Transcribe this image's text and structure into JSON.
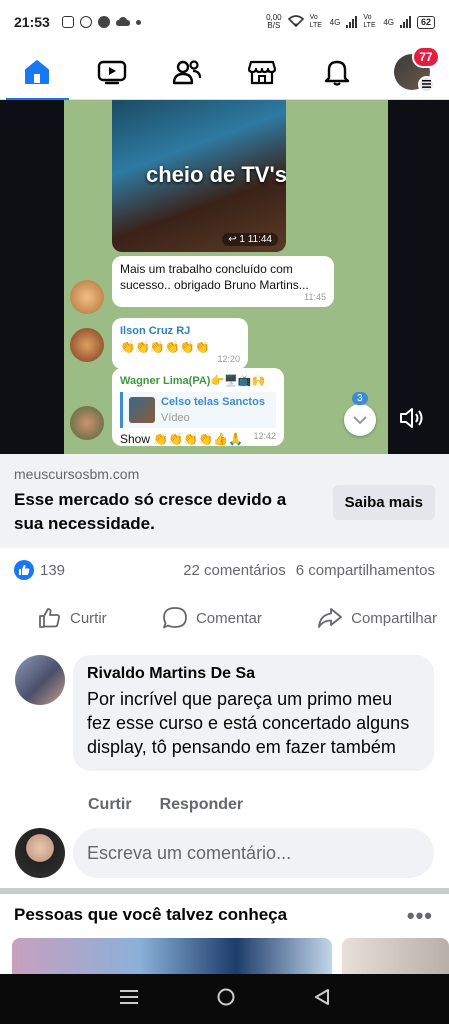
{
  "status_bar": {
    "time": "21:53",
    "net_rate_value": "0,00",
    "net_rate_unit": "B/S",
    "vo_lte_1": "Vo LTE",
    "net_1": "4G",
    "vo_lte_2": "Vo LTE",
    "net_2": "4G",
    "battery": "62"
  },
  "nav": {
    "tabs": [
      "home-tab",
      "video-tab",
      "friends-tab",
      "marketplace-tab",
      "notifications-tab",
      "menu-tab"
    ],
    "notification_badge": "77",
    "accent_color": "#1877f2"
  },
  "video": {
    "chat_image_title": "cheio de TV's",
    "chat_image_meta": "↩ 1 11:44",
    "bubble1_text": "Mais um trabalho concluído com sucesso.. obrigado Bruno Martins...",
    "bubble1_time": "11:45",
    "bubble2_name": "Ilson Cruz RJ",
    "bubble2_text": "👏👏👏👏👏👏",
    "bubble2_time": "12:20",
    "bubble3_name": "Wagner Lima(PA)👉🖥️📺🙌",
    "bubble3_reply_name": "Celso telas Sanctos",
    "bubble3_reply_sub": "Vídeo",
    "bubble3_text": "Show 👏👏👏👏👍🙏",
    "bubble3_time": "12:42",
    "scroll_badge": "3"
  },
  "ad": {
    "domain": "meuscursosbm.com",
    "headline": "Esse mercado só cresce devido a sua necessidade.",
    "cta": "Saiba mais"
  },
  "reactions": {
    "likes": "139",
    "comments": "22 comentários",
    "shares": "6 compartilhamentos"
  },
  "actions": {
    "like": "Curtir",
    "comment": "Comentar",
    "share": "Compartilhar"
  },
  "comment": {
    "author": "Rivaldo Martins De Sa",
    "text": "Por incrível que pareça um primo meu fez esse curso e está concertado alguns display, tô pensando em fazer também",
    "like": "Curtir",
    "reply": "Responder"
  },
  "write_comment": {
    "placeholder": "Escreva um comentário..."
  },
  "pymk": {
    "title": "Pessoas que você talvez conheça",
    "more": "•••"
  }
}
